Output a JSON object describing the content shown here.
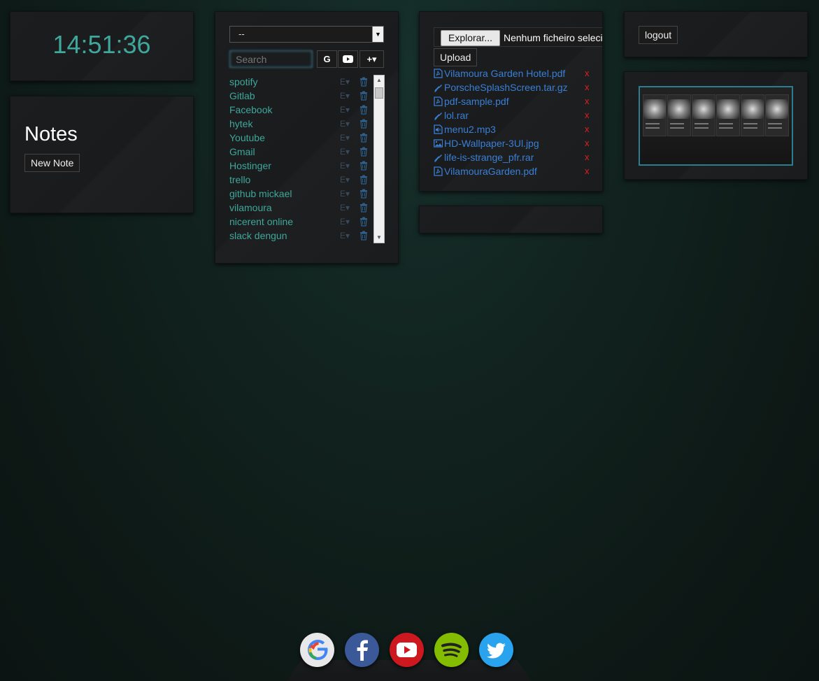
{
  "clock": {
    "time": "14:51:36"
  },
  "notes": {
    "title": "Notes",
    "new_note_label": "New Note"
  },
  "links": {
    "select_value": "--",
    "search_placeholder": "Search",
    "google_btn": "G",
    "add_btn": "+▾",
    "edit_glyph": "E▾",
    "items": [
      {
        "label": "spotify"
      },
      {
        "label": "Gitlab"
      },
      {
        "label": "Facebook"
      },
      {
        "label": "hytek"
      },
      {
        "label": "Youtube"
      },
      {
        "label": "Gmail"
      },
      {
        "label": "Hostinger"
      },
      {
        "label": "trello"
      },
      {
        "label": "github mickael"
      },
      {
        "label": "vilamoura"
      },
      {
        "label": "nicerent online"
      },
      {
        "label": "slack dengun"
      }
    ]
  },
  "files": {
    "browse_label": "Explorar...",
    "no_file_label": "Nenhum ficheiro selecionado",
    "upload_label": "Upload",
    "delete_glyph": "x",
    "items": [
      {
        "name": "Vilamoura Garden Hotel.pdf",
        "icon": "pdf-icon"
      },
      {
        "name": "PorscheSplashScreen.tar.gz",
        "icon": "archive-icon"
      },
      {
        "name": "pdf-sample.pdf",
        "icon": "pdf-icon"
      },
      {
        "name": "lol.rar",
        "icon": "archive-icon"
      },
      {
        "name": "menu2.mp3",
        "icon": "audio-icon"
      },
      {
        "name": "HD-Wallpaper-3Ul.jpg",
        "icon": "image-icon"
      },
      {
        "name": "life-is-strange_pfr.rar",
        "icon": "archive-icon"
      },
      {
        "name": "VilamouraGarden.pdf",
        "icon": "pdf-icon"
      }
    ]
  },
  "account": {
    "logout_label": "logout"
  },
  "dock": {
    "items": [
      {
        "name": "google",
        "color": "#e8e8e8"
      },
      {
        "name": "facebook",
        "color": "#3b5998"
      },
      {
        "name": "youtube",
        "color": "#cc181e"
      },
      {
        "name": "spotify",
        "color": "#84bd00"
      },
      {
        "name": "twitter",
        "color": "#2aa3ef"
      }
    ]
  },
  "colors": {
    "accent": "#3fa79b",
    "file_link": "#3b7fd4",
    "delete": "#e02020"
  }
}
